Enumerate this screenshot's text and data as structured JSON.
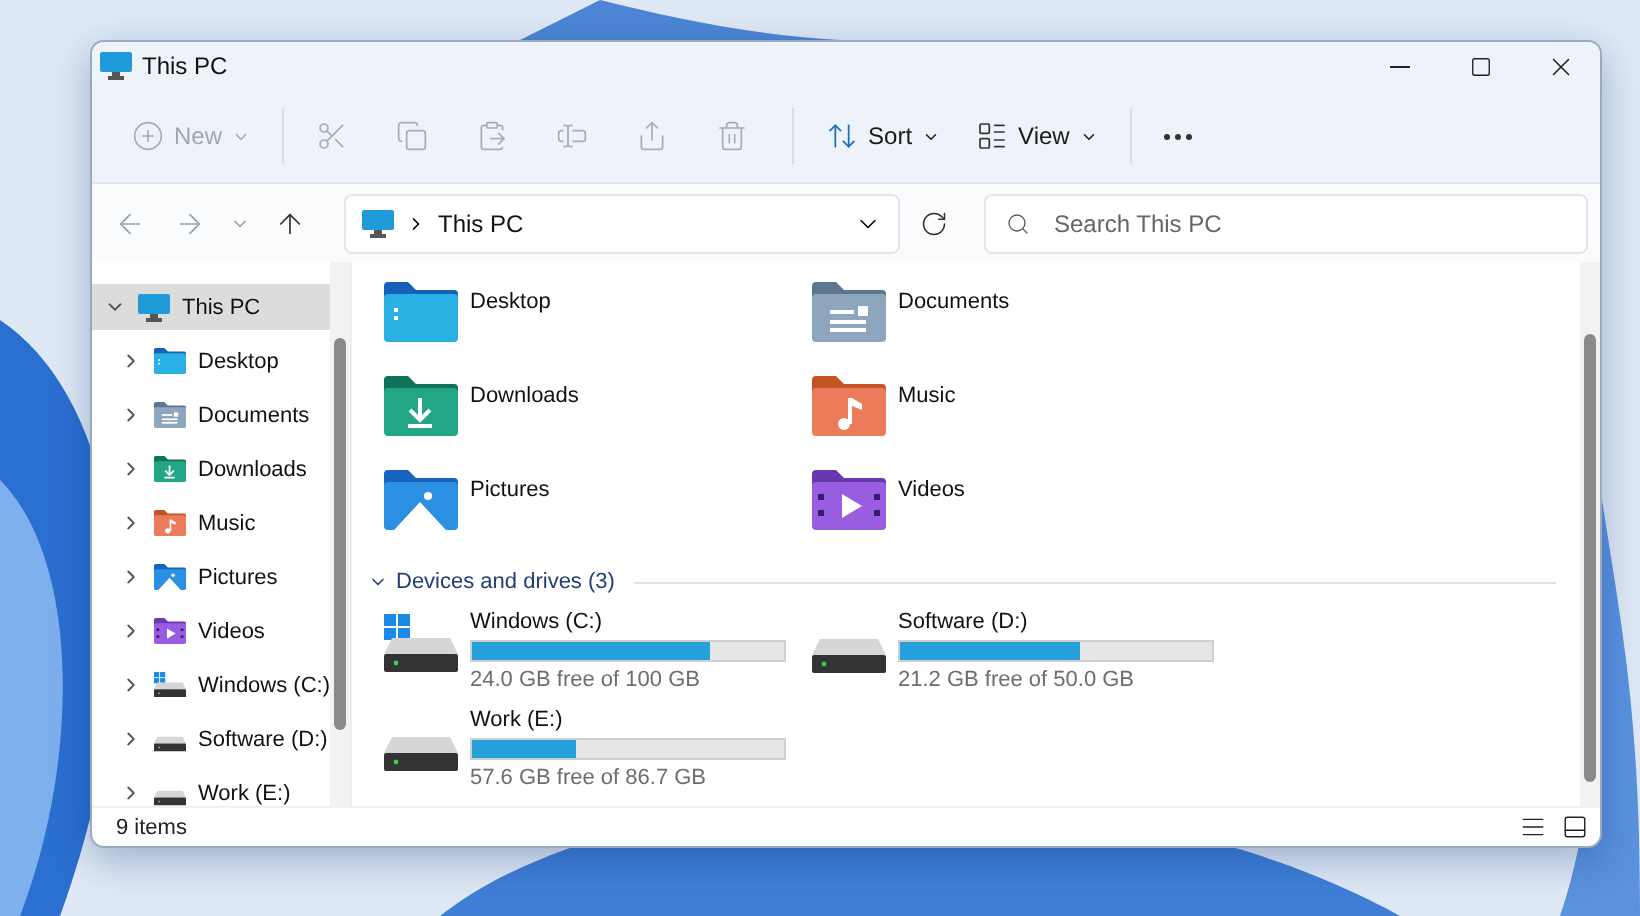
{
  "window": {
    "title": "This PC"
  },
  "toolbar": {
    "items": [
      {
        "kind": "new",
        "label": "New",
        "disabled": true
      },
      {
        "kind": "cut",
        "disabled": true
      },
      {
        "kind": "copy",
        "disabled": true
      },
      {
        "kind": "paste",
        "disabled": true
      },
      {
        "kind": "rename",
        "disabled": true
      },
      {
        "kind": "share",
        "disabled": true
      },
      {
        "kind": "delete",
        "disabled": true
      },
      {
        "kind": "sort",
        "label": "Sort",
        "disabled": false
      },
      {
        "kind": "view",
        "label": "View",
        "disabled": false
      },
      {
        "kind": "more",
        "disabled": false
      }
    ]
  },
  "address_bar": {
    "path": "This PC"
  },
  "search": {
    "placeholder": "Search This PC"
  },
  "sidebar": {
    "items": [
      {
        "label": "This PC",
        "kind": "pc",
        "selected": true,
        "expanded": true,
        "children": [
          {
            "label": "Desktop",
            "kind": "desktop",
            "selected": false,
            "expanded": false
          },
          {
            "label": "Documents",
            "kind": "documents",
            "selected": false,
            "expanded": false
          },
          {
            "label": "Downloads",
            "kind": "downloads",
            "selected": false,
            "expanded": false
          },
          {
            "label": "Music",
            "kind": "music",
            "selected": false,
            "expanded": false
          },
          {
            "label": "Pictures",
            "kind": "pictures",
            "selected": false,
            "expanded": false
          },
          {
            "label": "Videos",
            "kind": "videos",
            "selected": false,
            "expanded": false
          },
          {
            "label": "Windows (C:)",
            "kind": "system",
            "selected": false,
            "expanded": false
          },
          {
            "label": "Software (D:)",
            "kind": "drive",
            "selected": false,
            "expanded": false
          },
          {
            "label": "Work (E:)",
            "kind": "drive",
            "selected": false,
            "expanded": false
          }
        ]
      }
    ]
  },
  "folders": [
    {
      "label": "Desktop",
      "kind": "desktop"
    },
    {
      "label": "Documents",
      "kind": "documents"
    },
    {
      "label": "Downloads",
      "kind": "downloads"
    },
    {
      "label": "Music",
      "kind": "music"
    },
    {
      "label": "Pictures",
      "kind": "pictures"
    },
    {
      "label": "Videos",
      "kind": "videos"
    }
  ],
  "drives_section": {
    "title": "Devices and drives (3)",
    "expanded": true
  },
  "drives": [
    {
      "name": "Windows (C:)",
      "kind": "system",
      "level": 0.76,
      "free": "24.0 GB free of 100 GB"
    },
    {
      "name": "Software (D:)",
      "kind": "drive",
      "level": 0.576,
      "free": "21.2 GB free of 50.0 GB"
    },
    {
      "name": "Work (E:)",
      "kind": "drive",
      "level": 0.336,
      "free": "57.6 GB free of 86.7 GB"
    }
  ],
  "status_bar": {
    "count": "9 items"
  }
}
